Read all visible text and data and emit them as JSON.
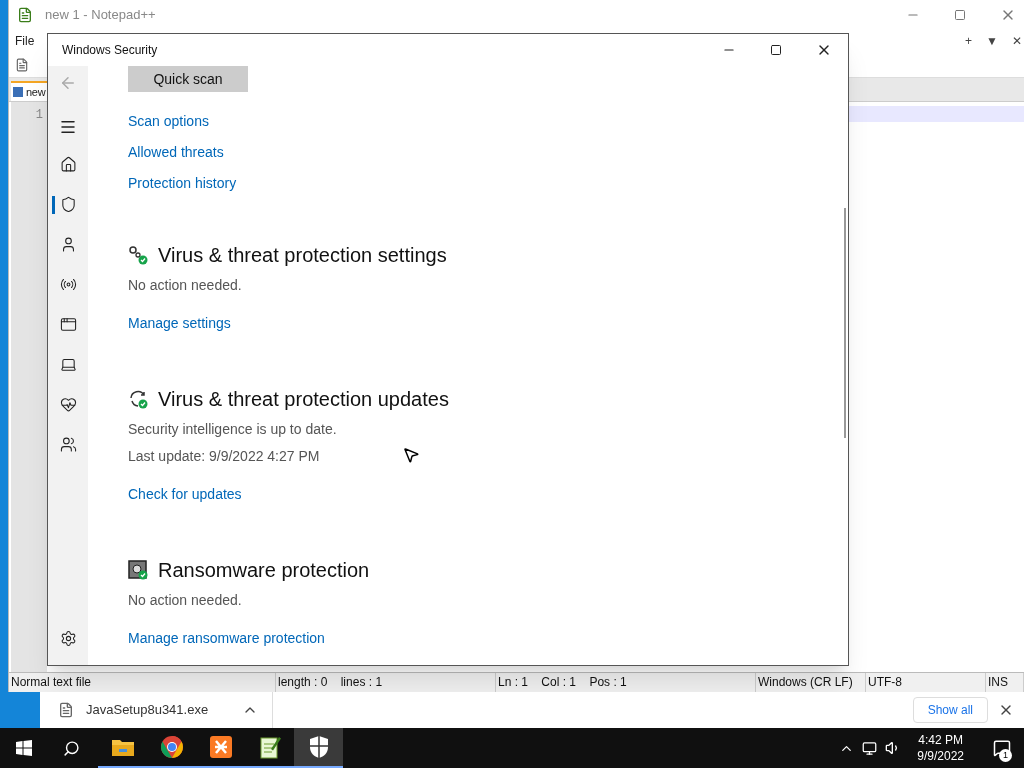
{
  "notepad": {
    "title": "new 1 - Notepad++",
    "menu": [
      "File"
    ],
    "tab_controls": [
      "+",
      "▼",
      "✕"
    ],
    "tab": "new",
    "line_numbers": [
      "1"
    ],
    "status_bar": [
      "Normal text file",
      "length : 0    lines : 1",
      "Ln : 1    Col : 1    Pos : 1",
      "Windows (CR LF)",
      "UTF-8",
      "INS"
    ]
  },
  "security": {
    "title": "Windows Security",
    "nav": [
      {
        "kind": "home",
        "selected": false
      },
      {
        "kind": "shield",
        "selected": true
      },
      {
        "kind": "account",
        "selected": false
      },
      {
        "kind": "network",
        "selected": false
      },
      {
        "kind": "app",
        "selected": false
      },
      {
        "kind": "device",
        "selected": false
      },
      {
        "kind": "health",
        "selected": false
      },
      {
        "kind": "family",
        "selected": false
      }
    ],
    "quick_scan": "Quick scan",
    "links": [
      "Scan options",
      "Allowed threats",
      "Protection history"
    ],
    "sections": [
      {
        "kind": "settings",
        "title": "Virus & threat protection settings",
        "lines": [
          "No action needed."
        ],
        "link": "Manage settings"
      },
      {
        "kind": "updates",
        "title": "Virus & threat protection updates",
        "lines": [
          "Security intelligence is up to date.",
          "Last update: 9/9/2022 4:27 PM"
        ],
        "link": "Check for updates"
      },
      {
        "kind": "ransomware",
        "title": "Ransomware protection",
        "lines": [
          "No action needed."
        ],
        "link": "Manage ransomware protection"
      }
    ]
  },
  "downloads": {
    "file": "JavaSetup8u341.exe",
    "show_all": "Show all"
  },
  "taskbar": {
    "apps": [
      {
        "kind": "explorer",
        "selected": false
      },
      {
        "kind": "chrome",
        "selected": false
      },
      {
        "kind": "xampp",
        "selected": false
      },
      {
        "kind": "notepad",
        "selected": false
      },
      {
        "kind": "security",
        "selected": true
      }
    ],
    "time": "4:42 PM",
    "date": "9/9/2022",
    "notifications": "1"
  }
}
